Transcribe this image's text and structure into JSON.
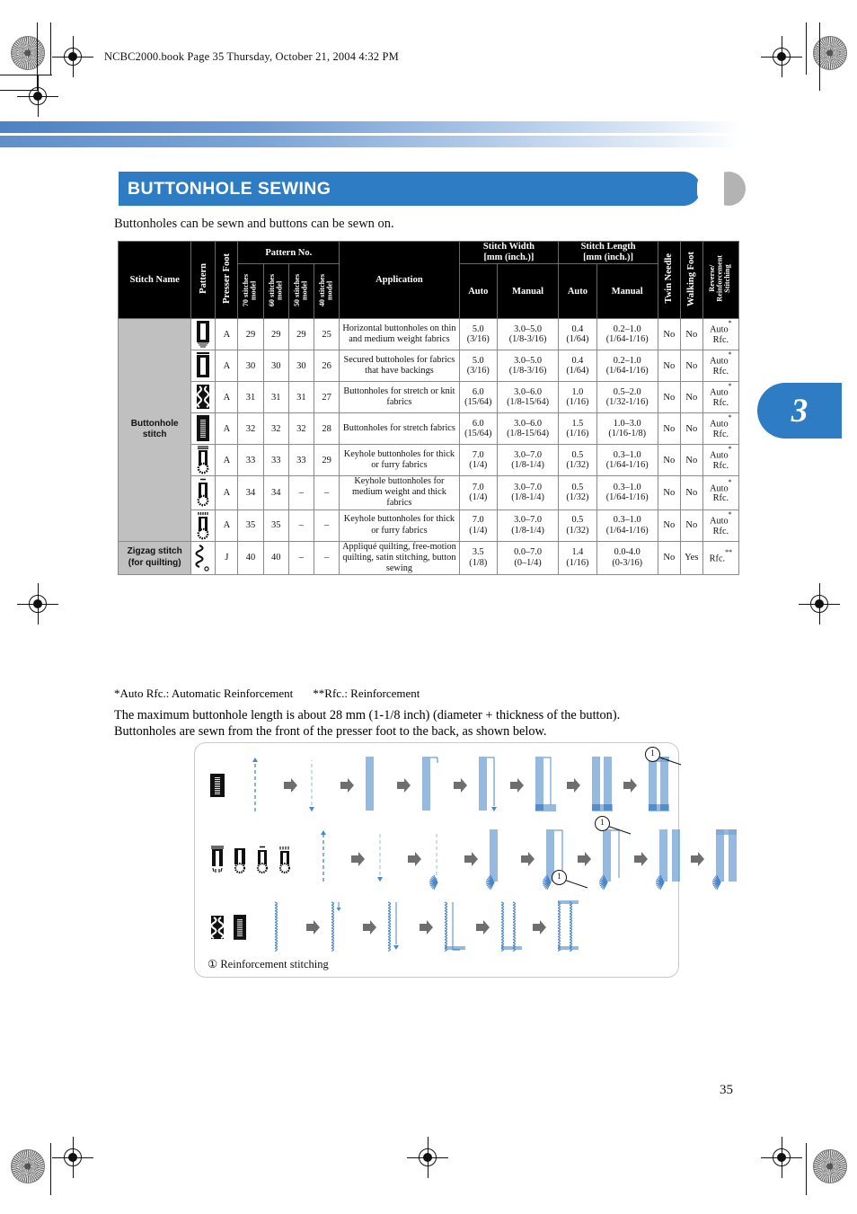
{
  "print_header": "NCBC2000.book  Page 35  Thursday, October 21, 2004  4:32 PM",
  "chapter_tab": {
    "number": "3"
  },
  "page_number": "35",
  "title": "BUTTONHOLE SEWING",
  "intro": "Buttonholes can be sewn and buttons can be sewn on.",
  "colors": {
    "accent_blue": "#2e7cc4",
    "tab_gray": "#b3b3b3",
    "row_label_gray": "#c0c0c0",
    "stitch_blue": "#4a86c8",
    "arrow_gray": "#6e6e6e"
  },
  "table": {
    "headers": {
      "stitch_name": "Stitch Name",
      "pattern": "Pattern",
      "presser_foot": "Presser Foot",
      "pattern_no": "Pattern No.",
      "models": [
        "70 stitches\nmodel",
        "60 stitches\nmodel",
        "50 stitches\nmodel",
        "40 stitches\nmodel"
      ],
      "application": "Application",
      "stitch_width": "Stitch Width\n[mm (inch.)]",
      "stitch_length": "Stitch Length\n[mm (inch.)]",
      "auto": "Auto",
      "manual": "Manual",
      "twin_needle": "Twin Needle",
      "walking_foot": "Walking Foot",
      "reverse_reinforcement": "Reverse/\nReinforcement\nStitching"
    },
    "groups": [
      {
        "label": "Buttonhole\nstitch",
        "row_count": 7
      },
      {
        "label": "Zigzag stitch\n(for quilting)",
        "row_count": 1
      }
    ],
    "rows": [
      {
        "pattern_icon": "buttonhole-bartack-icon",
        "presser_foot": "A",
        "model_70": "29",
        "model_60": "29",
        "model_50": "29",
        "model_40": "25",
        "application": "Horizontal buttonholes on thin and medium weight fabrics",
        "width_auto": "5.0\n(3/16)",
        "width_manual": "3.0–5.0\n(1/8-3/16)",
        "length_auto": "0.4\n(1/64)",
        "length_manual": "0.2–1.0\n(1/64-1/16)",
        "twin_needle": "No",
        "walking_foot": "No",
        "reverse": "Auto Rfc.",
        "reverse_mark": "*"
      },
      {
        "pattern_icon": "buttonhole-secured-icon",
        "presser_foot": "A",
        "model_70": "30",
        "model_60": "30",
        "model_50": "30",
        "model_40": "26",
        "application": "Secured buttoholes for fabrics that have backings",
        "width_auto": "5.0\n(3/16)",
        "width_manual": "3.0–5.0\n(1/8-3/16)",
        "length_auto": "0.4\n(1/64)",
        "length_manual": "0.2–1.0\n(1/64-1/16)",
        "twin_needle": "No",
        "walking_foot": "No",
        "reverse": "Auto Rfc.",
        "reverse_mark": "*"
      },
      {
        "pattern_icon": "buttonhole-stretch-icon",
        "presser_foot": "A",
        "model_70": "31",
        "model_60": "31",
        "model_50": "31",
        "model_40": "27",
        "application": "Buttonholes for stretch or knit fabrics",
        "width_auto": "6.0\n(15/64)",
        "width_manual": "3.0–6.0\n(1/8-15/64)",
        "length_auto": "1.0\n(1/16)",
        "length_manual": "0.5–2.0\n(1/32-1/16)",
        "twin_needle": "No",
        "walking_foot": "No",
        "reverse": "Auto Rfc.",
        "reverse_mark": "*"
      },
      {
        "pattern_icon": "buttonhole-stretch2-icon",
        "presser_foot": "A",
        "model_70": "32",
        "model_60": "32",
        "model_50": "32",
        "model_40": "28",
        "application": "Buttonholes for stretch fabrics",
        "width_auto": "6.0\n(15/64)",
        "width_manual": "3.0–6.0\n(1/8-15/64)",
        "length_auto": "1.5\n(1/16)",
        "length_manual": "1.0–3.0\n(1/16-1/8)",
        "twin_needle": "No",
        "walking_foot": "No",
        "reverse": "Auto Rfc.",
        "reverse_mark": "*"
      },
      {
        "pattern_icon": "keyhole-buttonhole-icon",
        "presser_foot": "A",
        "model_70": "33",
        "model_60": "33",
        "model_50": "33",
        "model_40": "29",
        "application": "Keyhole buttonholes for thick or furry fabrics",
        "width_auto": "7.0\n(1/4)",
        "width_manual": "3.0–7.0\n(1/8-1/4)",
        "length_auto": "0.5\n(1/32)",
        "length_manual": "0.3–1.0\n(1/64-1/16)",
        "twin_needle": "No",
        "walking_foot": "No",
        "reverse": "Auto Rfc.",
        "reverse_mark": "*"
      },
      {
        "pattern_icon": "keyhole-buttonhole-medium-icon",
        "presser_foot": "A",
        "model_70": "34",
        "model_60": "34",
        "model_50": "–",
        "model_40": "–",
        "application": "Keyhole buttonholes for medium weight and thick fabrics",
        "width_auto": "7.0\n(1/4)",
        "width_manual": "3.0–7.0\n(1/8-1/4)",
        "length_auto": "0.5\n(1/32)",
        "length_manual": "0.3–1.0\n(1/64-1/16)",
        "twin_needle": "No",
        "walking_foot": "No",
        "reverse": "Auto Rfc.",
        "reverse_mark": "*"
      },
      {
        "pattern_icon": "keyhole-buttonhole-thick-icon",
        "presser_foot": "A",
        "model_70": "35",
        "model_60": "35",
        "model_50": "–",
        "model_40": "–",
        "application": "Keyhole buttonholes for thick or furry fabrics",
        "width_auto": "7.0\n(1/4)",
        "width_manual": "3.0–7.0\n(1/8-1/4)",
        "length_auto": "0.5\n(1/32)",
        "length_manual": "0.3–1.0\n(1/64-1/16)",
        "twin_needle": "No",
        "walking_foot": "No",
        "reverse": "Auto Rfc.",
        "reverse_mark": "*"
      },
      {
        "pattern_icon": "zigzag-stitch-icon",
        "presser_foot": "J",
        "model_70": "40",
        "model_60": "40",
        "model_50": "–",
        "model_40": "–",
        "application": "Appliqué quilting, free-motion quilting, satin stitching, button sewing",
        "width_auto": "3.5\n(1/8)",
        "width_manual": "0.0–7.0\n(0–1/4)",
        "length_auto": "1.4\n(1/16)",
        "length_manual": "0.0-4.0\n(0-3/16)",
        "twin_needle": "No",
        "walking_foot": "Yes",
        "reverse": "Rfc.",
        "reverse_mark": "**"
      }
    ]
  },
  "footnotes": {
    "legend_auto": "*Auto Rfc.: Automatic Reinforcement",
    "legend_rfc": "**Rfc.: Reinforcement",
    "line1": "The maximum buttonhole length is about 28 mm (1-1/8 inch) (diameter + thickness of the button).",
    "line2": "Buttonholes are sewn from the front of the presser foot to the back, as shown below."
  },
  "diagram": {
    "caption": "① Reinforcement stitching",
    "callout_label": "1",
    "rows": [
      {
        "icons": [
          "buttonhole-bartack-icon"
        ],
        "step_count": 8
      },
      {
        "icons": [
          "keyhole-a-icon",
          "keyhole-b-icon",
          "keyhole-c-icon",
          "keyhole-d-icon"
        ],
        "step_count": 8
      },
      {
        "icons": [
          "zigzag-bar-icon",
          "dense-bar-icon"
        ],
        "step_count": 6
      }
    ]
  }
}
